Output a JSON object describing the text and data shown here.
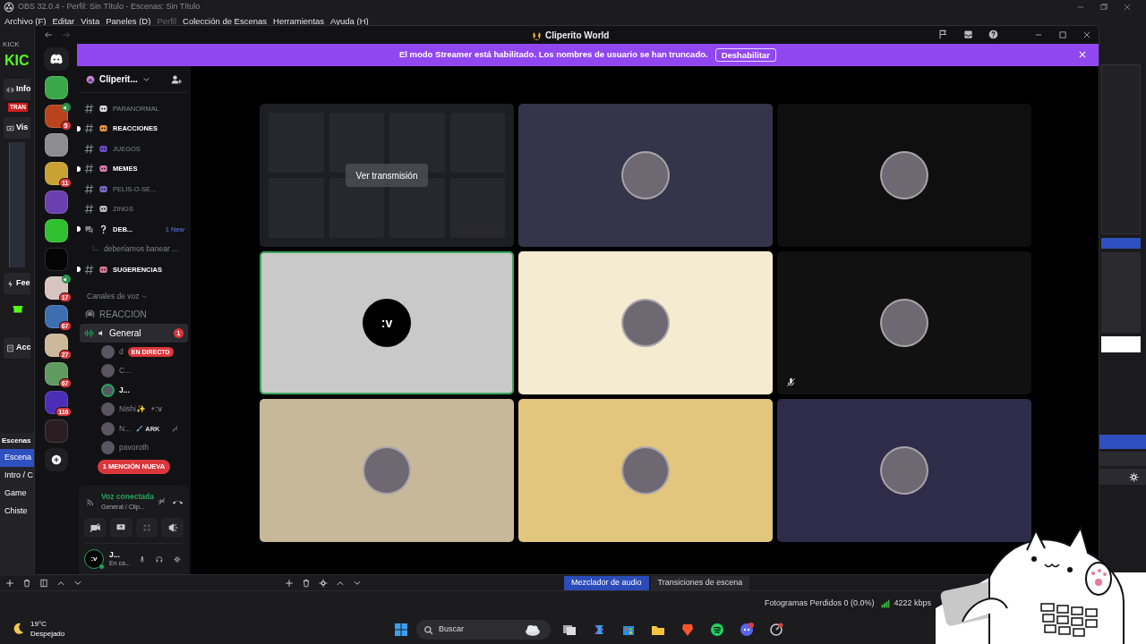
{
  "obs": {
    "title": "OBS 32.0.4 - Perfil: Sin Título - Escenas: Sin Título",
    "menu": [
      {
        "label": "Archivo (F)",
        "disabled": false
      },
      {
        "label": "Editar",
        "disabled": false
      },
      {
        "label": "Vista",
        "disabled": false
      },
      {
        "label": "Paneles (D)",
        "disabled": false
      },
      {
        "label": "Perfil",
        "disabled": true
      },
      {
        "label": "Colección de Escenas",
        "disabled": false
      },
      {
        "label": "Herramientas",
        "disabled": false
      },
      {
        "label": "Ayuda (H)",
        "disabled": false
      }
    ],
    "dock_title": "KICK",
    "logo_text": "KIC",
    "live_tag": "TRAN",
    "docks": [
      {
        "label": "Info"
      },
      {
        "label": "Vis"
      },
      {
        "label": "Fee"
      },
      {
        "label": "Acc"
      }
    ],
    "scenes": {
      "title": "Escenas",
      "items": [
        {
          "label": "Escena",
          "selected": true
        },
        {
          "label": "Intro / C",
          "selected": false
        },
        {
          "label": "Game",
          "selected": false
        },
        {
          "label": "Chiste",
          "selected": false
        }
      ]
    },
    "dock_tabs": [
      {
        "label": "Mezclador de audio",
        "selected": true
      },
      {
        "label": "Transiciones de escena",
        "selected": false
      }
    ],
    "status_bar": {
      "dropped_frames": "Fotogramas Perdidos 0 (0.0%)",
      "bitrate": "4222 kbps"
    }
  },
  "discord": {
    "title": "Cliperito World",
    "banner": {
      "text": "El modo Streamer está habilitado. Los nombres de usuario se han truncado.",
      "button": "Deshabilitar"
    },
    "servers": [
      {
        "color": "#3aa84a"
      },
      {
        "color": "#b8431c",
        "voice": true,
        "badge": "5"
      },
      {
        "color": "#8d8d8f"
      },
      {
        "color": "#c8a232",
        "badge": "11"
      },
      {
        "color": "#6b3fb0"
      },
      {
        "color": "#2fbf2f"
      },
      {
        "color": "#050505"
      },
      {
        "color": "#d7c4c0",
        "voice": true,
        "badge": "17"
      },
      {
        "color": "#3d6fb0",
        "badge": "67"
      },
      {
        "color": "#cdb89a",
        "badge": "27"
      },
      {
        "color": "#5f9a60",
        "badge": "67"
      },
      {
        "color": "#4b2db8",
        "badge": "116"
      },
      {
        "color": "#2a1d22"
      }
    ],
    "server_name": "Cliperit...",
    "channels": [
      {
        "kind": "text",
        "name": "PARANORMAL",
        "unread": false
      },
      {
        "kind": "text",
        "name": "REACCIONES",
        "unread": true
      },
      {
        "kind": "text",
        "name": "JUEGOS",
        "unread": false
      },
      {
        "kind": "text",
        "name": "MEMES",
        "unread": true
      },
      {
        "kind": "text",
        "name": "PELIS-O-SE...",
        "unread": false
      },
      {
        "kind": "text",
        "name": "ZINGS",
        "unread": false
      },
      {
        "kind": "forum",
        "name": "DEB...",
        "unread": true,
        "new_label": "1 New",
        "children": [
          {
            "kind": "thread",
            "name": "deberíamos banear ...",
            "unread": false
          }
        ]
      },
      {
        "kind": "text",
        "name": "SUGERENCIAS",
        "unread": true
      }
    ],
    "voice_category": "Canales de voz",
    "voice_channels": [
      {
        "name": "REACCION",
        "selected": false
      },
      {
        "name": "General",
        "selected": true,
        "badge": "1",
        "members": [
          {
            "name": "d",
            "speaking": false,
            "live_tag": "EN DIRECTO"
          },
          {
            "name": "C...",
            "speaking": false
          },
          {
            "name": "J...",
            "speaking": true
          },
          {
            "name": "Nishi✨",
            "speaking": false,
            "status": "⚡:v"
          },
          {
            "name": "N...",
            "speaking": false,
            "clan_tag": "ARK"
          },
          {
            "name": "pavoroth",
            "speaking": false
          }
        ]
      }
    ],
    "mention_pill": "1 MENCIÓN NUEVA",
    "voice_panel": {
      "status": "Voz conectada",
      "channel": "General / Clip..."
    },
    "user": {
      "name": "J...",
      "status": "En ca...",
      "avatar_text": ":v"
    },
    "tiles": [
      {
        "kind": "stream",
        "color": "#1e1f24",
        "selected": false,
        "button": "Ver transmisión"
      },
      {
        "kind": "avatar",
        "color": "#34344a",
        "selected": false
      },
      {
        "kind": "avatar",
        "color": "#0f0f10",
        "selected": false
      },
      {
        "kind": "avatar",
        "color": "#c9c9c9",
        "selected": true,
        "avatar_text": ":v"
      },
      {
        "kind": "avatar",
        "color": "#f4ebd0",
        "selected": false
      },
      {
        "kind": "avatar",
        "color": "#121111",
        "selected": false,
        "muted": true
      },
      {
        "kind": "avatar",
        "color": "#c6b899",
        "selected": false
      },
      {
        "kind": "avatar",
        "color": "#e2c67d",
        "selected": false
      },
      {
        "kind": "avatar",
        "color": "#2f2c49",
        "selected": false
      }
    ]
  },
  "taskbar": {
    "temperature": "19°C",
    "weather": "Despejado",
    "search": "Buscar"
  }
}
